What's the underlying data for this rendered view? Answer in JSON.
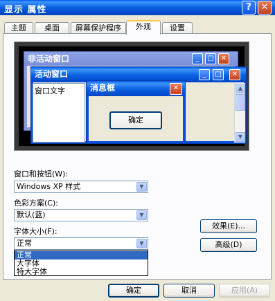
{
  "window": {
    "title": "显示 属性",
    "help_label": "?",
    "close_label": "✕"
  },
  "tabs": [
    {
      "label": "主题"
    },
    {
      "label": "桌面"
    },
    {
      "label": "屏幕保护程序"
    },
    {
      "label": "外观",
      "active": true
    },
    {
      "label": "设置"
    }
  ],
  "preview": {
    "inactive_title": "非活动窗口",
    "active_title": "活动窗口",
    "window_text": "窗口文字",
    "message_title": "消息框",
    "ok_label": "确定"
  },
  "form": {
    "style_label": "窗口和按钮(W):",
    "style_value": "Windows XP 样式",
    "color_label": "色彩方案(C):",
    "color_value": "默认(蓝)",
    "font_label": "字体大小(F):",
    "font_value": "正常",
    "font_options": [
      "正常",
      "大字体",
      "特大字体"
    ],
    "effects_label": "效果(E)...",
    "advanced_label": "高级(D)"
  },
  "footer": {
    "ok_label": "确定",
    "cancel_label": "取消",
    "apply_label": "应用(A)"
  }
}
